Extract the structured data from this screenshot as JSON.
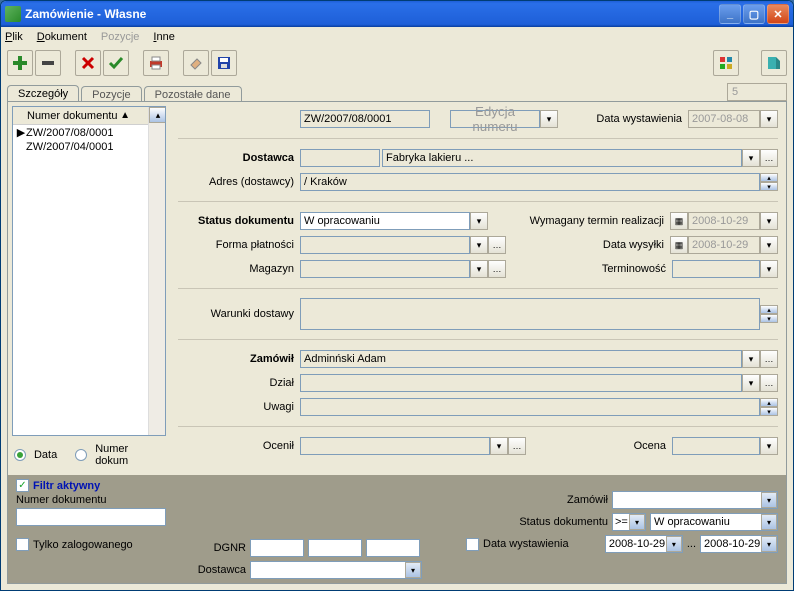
{
  "window": {
    "title": "Zamówienie - Własne"
  },
  "menu": {
    "plik": "Plik",
    "dokument": "Dokument",
    "pozycje": "Pozycje",
    "inne": "Inne"
  },
  "page_num": "5",
  "tabs": {
    "t0": "Szczegóły",
    "t1": "Pozycje",
    "t2": "Pozostałe dane"
  },
  "doclist": {
    "header": "Numer dokumentu",
    "rows": [
      "ZW/2007/08/0001",
      "ZW/2007/04/0001"
    ]
  },
  "form": {
    "docnum": "ZW/2007/08/0001",
    "edycja_btn": "Edycja numeru",
    "data_wyst_lbl": "Data wystawienia",
    "data_wyst": "2007-08-08",
    "dostawca_lbl": "Dostawca",
    "dostawca_val": "Fabryka lakieru ...",
    "adres_lbl": "Adres (dostawcy)",
    "adres_val": "/  Kraków",
    "status_lbl": "Status dokumentu",
    "status_val": "W opracowaniu",
    "wymag_lbl": "Wymagany termin realizacji",
    "wymag_val": "2008-10-29",
    "forma_lbl": "Forma płatności",
    "wysylki_lbl": "Data wysyłki",
    "wysylki_val": "2008-10-29",
    "magazyn_lbl": "Magazyn",
    "termin_lbl": "Terminowość",
    "warunki_lbl": "Warunki dostawy",
    "zamowil_lbl": "Zamówił",
    "zamowil_val": "Adminński Adam",
    "dzial_lbl": "Dział",
    "uwagi_lbl": "Uwagi",
    "ocenil_lbl": "Ocenił",
    "ocena_lbl": "Ocena"
  },
  "radios": {
    "data": "Data",
    "num": "Numer dokum"
  },
  "filter": {
    "aktywny": "Filtr aktywny",
    "numdok": "Numer dokumentu",
    "tylko": "Tylko zalogowanego",
    "dgnr": "DGNR",
    "dostawca": "Dostawca",
    "zamowil": "Zamówił",
    "status": "Status dokumentu",
    "status_op": ">= ",
    "status_val": "W opracowaniu",
    "datawyst": "Data wystawienia",
    "date1": "2008-10-29",
    "dots": "...",
    "date2": "2008-10-29"
  }
}
